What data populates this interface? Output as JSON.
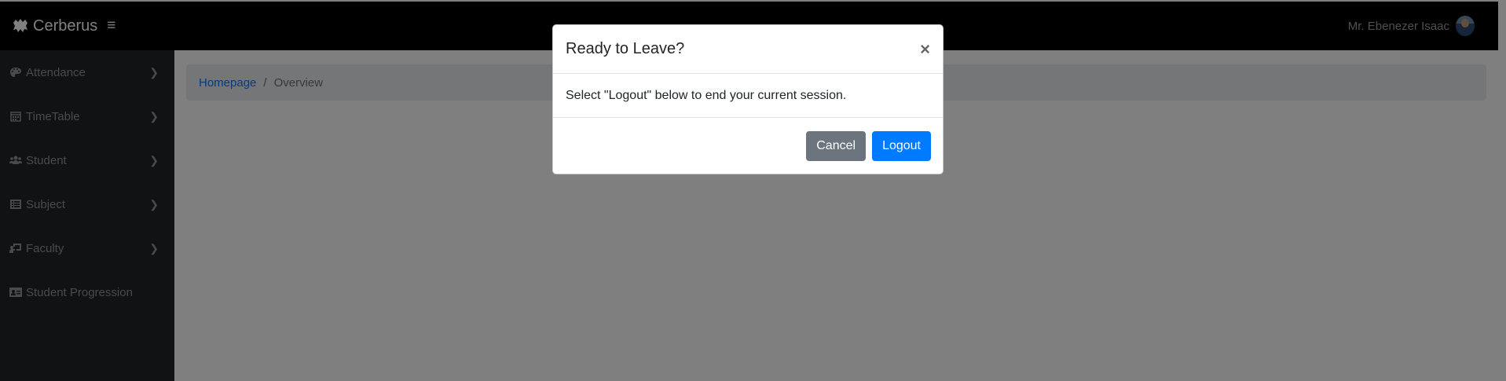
{
  "app": {
    "brand": "Cerberus"
  },
  "header": {
    "user_name": "Mr. Ebenezer Isaac"
  },
  "sidebar": {
    "items": [
      {
        "label": "Attendance",
        "icon": "palette-icon",
        "has_submenu": true
      },
      {
        "label": "TimeTable",
        "icon": "calendar-icon",
        "has_submenu": true
      },
      {
        "label": "Student",
        "icon": "users-icon",
        "has_submenu": true
      },
      {
        "label": "Subject",
        "icon": "list-icon",
        "has_submenu": true
      },
      {
        "label": "Faculty",
        "icon": "chalkboard-teacher-icon",
        "has_submenu": true
      },
      {
        "label": "Student Progression",
        "icon": "id-card-icon",
        "has_submenu": false
      }
    ]
  },
  "breadcrumb": {
    "home": "Homepage",
    "separator": "/",
    "current": "Overview"
  },
  "modal": {
    "title": "Ready to Leave?",
    "close_symbol": "×",
    "body": "Select \"Logout\" below to end your current session.",
    "cancel_label": "Cancel",
    "logout_label": "Logout"
  },
  "colors": {
    "primary": "#007bff",
    "secondary": "#6c757d",
    "sidebar_bg": "#212529",
    "topbar_bg": "#000000"
  }
}
